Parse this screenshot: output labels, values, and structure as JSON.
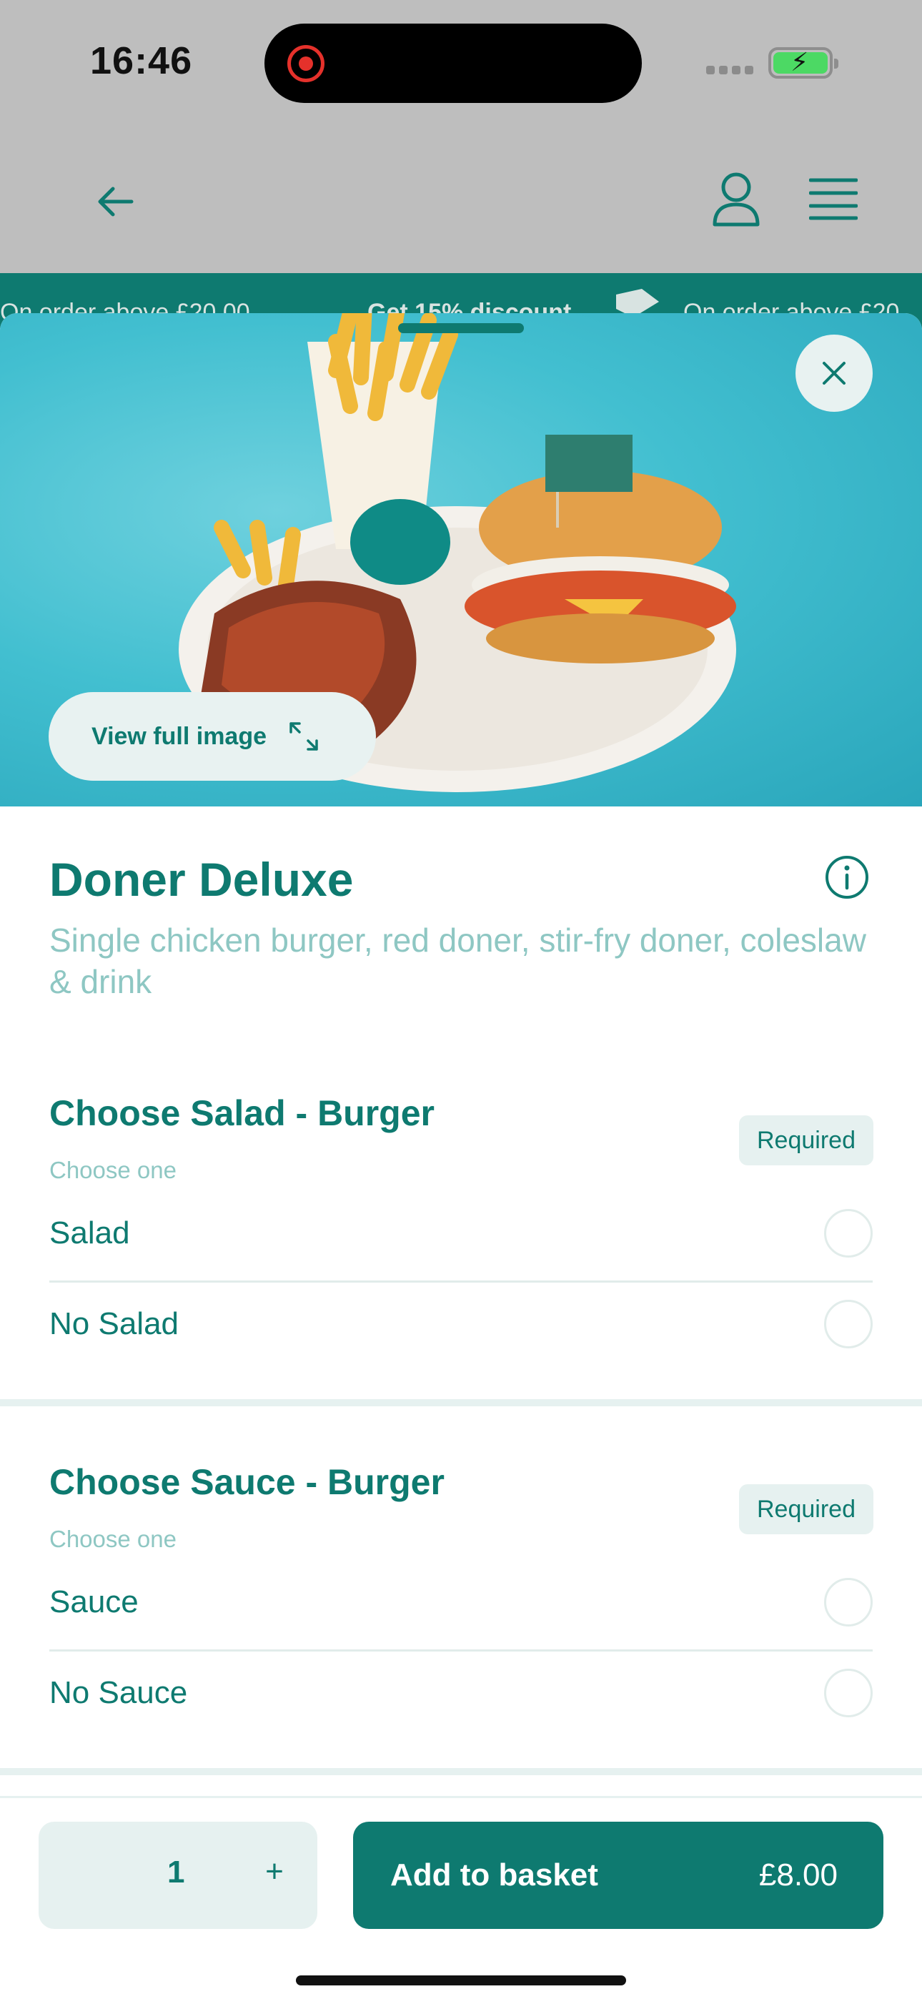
{
  "status_bar": {
    "time": "16:46"
  },
  "promo": {
    "text_left": "On order above £20.00",
    "text_center": "Get 15% discount",
    "text_right": "On order above £20"
  },
  "hero": {
    "view_full_label": "View full image"
  },
  "product": {
    "title": "Doner Deluxe",
    "description": "Single chicken burger, red doner, stir-fry doner, coleslaw & drink"
  },
  "groups": [
    {
      "title": "Choose Salad - Burger",
      "subtitle": "Choose one",
      "badge": "Required",
      "options": [
        "Salad",
        "No Salad"
      ]
    },
    {
      "title": "Choose Sauce - Burger",
      "subtitle": "Choose one",
      "badge": "Required",
      "options": [
        "Sauce",
        "No Sauce"
      ]
    }
  ],
  "bottom_bar": {
    "quantity": "1",
    "plus": "+",
    "add_label": "Add to basket",
    "price": "£8.00"
  },
  "colors": {
    "accent": "#0e7a70",
    "accent_light": "#e6f1f0",
    "muted_text": "#8ec7c3",
    "overlay_gray": "#bebebe"
  }
}
